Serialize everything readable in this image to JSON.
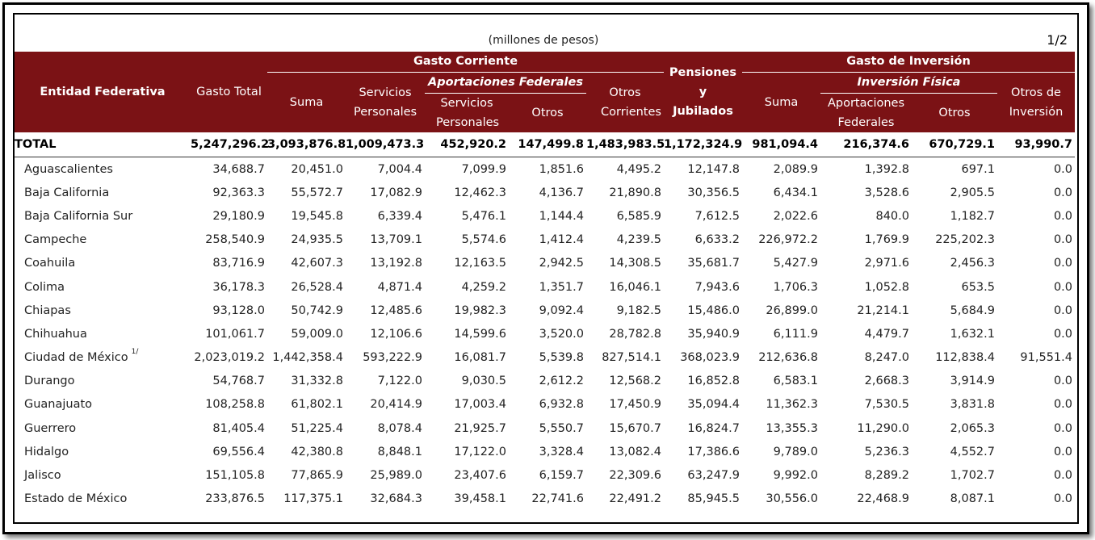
{
  "unit_label": "(millones de pesos)",
  "page_label": "1/2",
  "headers": {
    "entidad": "Entidad Federativa",
    "gasto_total": "Gasto Total",
    "gasto_corriente": "Gasto Corriente",
    "suma": "Suma",
    "servicios_personales": "Servicios Personales",
    "aportaciones_federales": "Aportaciones Federales",
    "ap_servicios_personales": "Servicios Personales",
    "otros": "Otros",
    "otros_corrientes": "Otros Corrientes",
    "pensiones": "Pensiones y Jubilados",
    "gasto_inversion": "Gasto de Inversión",
    "suma_inv": "Suma",
    "inversion_fisica": "Inversión Física",
    "aportaciones_federales_inv": "Aportaciones Federales",
    "otros_inv": "Otros",
    "otros_de_inversion": "Otros de Inversión"
  },
  "total_row": {
    "name": "TOTAL",
    "values": [
      "5,247,296.2",
      "3,093,876.8",
      "1,009,473.3",
      "452,920.2",
      "147,499.8",
      "1,483,983.5",
      "1,172,324.9",
      "981,094.4",
      "216,374.6",
      "670,729.1",
      "93,990.7"
    ]
  },
  "rows": [
    {
      "name": "Aguascalientes",
      "note": "",
      "values": [
        "34,688.7",
        "20,451.0",
        "7,004.4",
        "7,099.9",
        "1,851.6",
        "4,495.2",
        "12,147.8",
        "2,089.9",
        "1,392.8",
        "697.1",
        "0.0"
      ]
    },
    {
      "name": "Baja California",
      "note": "",
      "values": [
        "92,363.3",
        "55,572.7",
        "17,082.9",
        "12,462.3",
        "4,136.7",
        "21,890.8",
        "30,356.5",
        "6,434.1",
        "3,528.6",
        "2,905.5",
        "0.0"
      ]
    },
    {
      "name": "Baja California Sur",
      "note": "",
      "values": [
        "29,180.9",
        "19,545.8",
        "6,339.4",
        "5,476.1",
        "1,144.4",
        "6,585.9",
        "7,612.5",
        "2,022.6",
        "840.0",
        "1,182.7",
        "0.0"
      ]
    },
    {
      "name": "Campeche",
      "note": "",
      "values": [
        "258,540.9",
        "24,935.5",
        "13,709.1",
        "5,574.6",
        "1,412.4",
        "4,239.5",
        "6,633.2",
        "226,972.2",
        "1,769.9",
        "225,202.3",
        "0.0"
      ]
    },
    {
      "name": "Coahuila",
      "note": "",
      "values": [
        "83,716.9",
        "42,607.3",
        "13,192.8",
        "12,163.5",
        "2,942.5",
        "14,308.5",
        "35,681.7",
        "5,427.9",
        "2,971.6",
        "2,456.3",
        "0.0"
      ]
    },
    {
      "name": "Colima",
      "note": "",
      "values": [
        "36,178.3",
        "26,528.4",
        "4,871.4",
        "4,259.2",
        "1,351.7",
        "16,046.1",
        "7,943.6",
        "1,706.3",
        "1,052.8",
        "653.5",
        "0.0"
      ]
    },
    {
      "name": "Chiapas",
      "note": "",
      "values": [
        "93,128.0",
        "50,742.9",
        "12,485.6",
        "19,982.3",
        "9,092.4",
        "9,182.5",
        "15,486.0",
        "26,899.0",
        "21,214.1",
        "5,684.9",
        "0.0"
      ]
    },
    {
      "name": "Chihuahua",
      "note": "",
      "values": [
        "101,061.7",
        "59,009.0",
        "12,106.6",
        "14,599.6",
        "3,520.0",
        "28,782.8",
        "35,940.9",
        "6,111.9",
        "4,479.7",
        "1,632.1",
        "0.0"
      ]
    },
    {
      "name": "Ciudad de México",
      "note": "1/",
      "values": [
        "2,023,019.2",
        "1,442,358.4",
        "593,222.9",
        "16,081.7",
        "5,539.8",
        "827,514.1",
        "368,023.9",
        "212,636.8",
        "8,247.0",
        "112,838.4",
        "91,551.4"
      ]
    },
    {
      "name": "Durango",
      "note": "",
      "values": [
        "54,768.7",
        "31,332.8",
        "7,122.0",
        "9,030.5",
        "2,612.2",
        "12,568.2",
        "16,852.8",
        "6,583.1",
        "2,668.3",
        "3,914.9",
        "0.0"
      ]
    },
    {
      "name": "Guanajuato",
      "note": "",
      "values": [
        "108,258.8",
        "61,802.1",
        "20,414.9",
        "17,003.4",
        "6,932.8",
        "17,450.9",
        "35,094.4",
        "11,362.3",
        "7,530.5",
        "3,831.8",
        "0.0"
      ]
    },
    {
      "name": "Guerrero",
      "note": "",
      "values": [
        "81,405.4",
        "51,225.4",
        "8,078.4",
        "21,925.7",
        "5,550.7",
        "15,670.7",
        "16,824.7",
        "13,355.3",
        "11,290.0",
        "2,065.3",
        "0.0"
      ]
    },
    {
      "name": "Hidalgo",
      "note": "",
      "values": [
        "69,556.4",
        "42,380.8",
        "8,848.1",
        "17,122.0",
        "3,328.4",
        "13,082.4",
        "17,386.6",
        "9,789.0",
        "5,236.3",
        "4,552.7",
        "0.0"
      ]
    },
    {
      "name": "Jalisco",
      "note": "",
      "values": [
        "151,105.8",
        "77,865.9",
        "25,989.0",
        "23,407.6",
        "6,159.7",
        "22,309.6",
        "63,247.9",
        "9,992.0",
        "8,289.2",
        "1,702.7",
        "0.0"
      ]
    },
    {
      "name": "Estado de México",
      "note": "",
      "values": [
        "233,876.5",
        "117,375.1",
        "32,684.3",
        "39,458.1",
        "22,741.6",
        "22,491.2",
        "85,945.5",
        "30,556.0",
        "22,468.9",
        "8,087.1",
        "0.0"
      ]
    }
  ],
  "colors": {
    "header_bg": "#7b1215",
    "header_text": "#ffffff"
  }
}
